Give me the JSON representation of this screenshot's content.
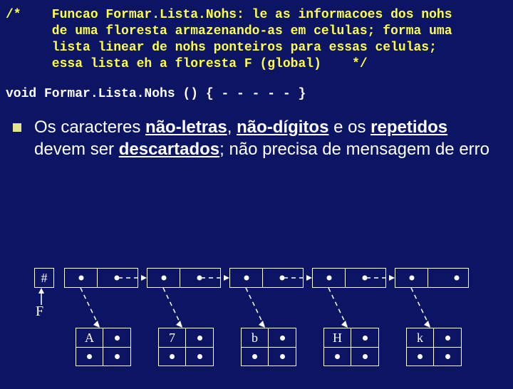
{
  "comment": "/*    Funcao Formar.Lista.Nohs: le as informacoes dos nohs\n      de uma floresta armazenando-as em celulas; forma uma\n      lista linear de nohs ponteiros para essas celulas;\n      essa lista eh a floresta F (global)    */",
  "declaration": "void Formar.Lista.Nohs () { - - - - - }",
  "bullet_text": {
    "p1": "Os caracteres ",
    "b1": "não-letras",
    "c1": ", ",
    "b2": "não-dígitos",
    "p2": " e os ",
    "b3": "repetidos",
    "p3": " devem ser ",
    "b4": "descartados",
    "p4": "; não precisa de mensagem de erro"
  },
  "diagram": {
    "head_label": "#",
    "list_name": "F",
    "node_labels": [
      "A",
      "7",
      "b",
      "H",
      "k"
    ]
  }
}
